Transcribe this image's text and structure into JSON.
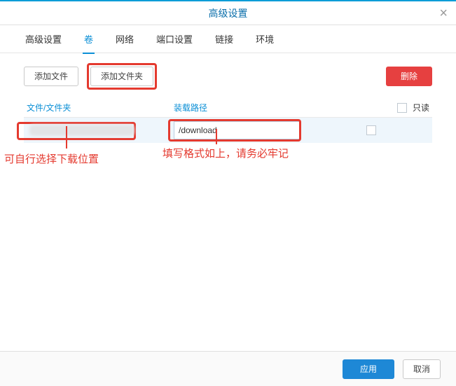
{
  "window": {
    "title": "高级设置"
  },
  "tabs": [
    {
      "label": "高级设置"
    },
    {
      "label": "卷"
    },
    {
      "label": "网络"
    },
    {
      "label": "端口设置"
    },
    {
      "label": "链接"
    },
    {
      "label": "环境"
    }
  ],
  "toolbar": {
    "add_file": "添加文件",
    "add_folder": "添加文件夹",
    "delete": "删除"
  },
  "table": {
    "headers": {
      "col1": "文件/文件夹",
      "col2": "装载路径",
      "col3": "只读"
    },
    "rows": [
      {
        "path_display": "",
        "mount": "/download",
        "readonly": false
      }
    ]
  },
  "footer": {
    "apply": "应用",
    "cancel": "取消"
  },
  "annotations": {
    "left": "可自行选择下载位置",
    "right": "填写格式如上，请务必牢记"
  }
}
